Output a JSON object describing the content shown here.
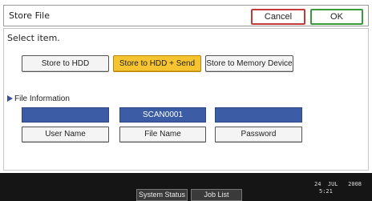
{
  "header": {
    "title": "Store File",
    "cancel_label": "Cancel",
    "ok_label": "OK"
  },
  "instruction": "Select item.",
  "store_options": [
    {
      "label": "Store to HDD",
      "selected": false
    },
    {
      "label": "Store to HDD + Send",
      "selected": true
    },
    {
      "label": "Store to Memory Device",
      "selected": false
    }
  ],
  "file_info": {
    "section_label": "File Information",
    "fields": [
      {
        "value": "",
        "label": "User Name"
      },
      {
        "value": "SCAN0001",
        "label": "File Name"
      },
      {
        "value": "",
        "label": "Password"
      }
    ]
  },
  "status_bar": {
    "system_status_label": "System Status",
    "job_list_label": "Job List",
    "date_line1": "24  JUL   2008",
    "date_line2": "5:21"
  },
  "colors": {
    "selected_option": "#f7c431",
    "field_value_bg": "#3c5ca6",
    "cancel_border": "#c23a3a",
    "ok_border": "#3a9a3a"
  }
}
